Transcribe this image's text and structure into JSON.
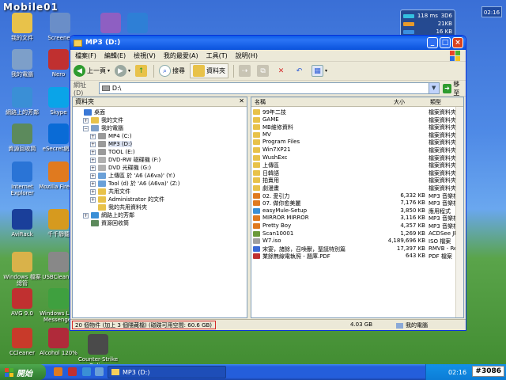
{
  "watermark": "Mobile01",
  "desktop_icons": [
    {
      "label": "我的文件",
      "color": "#e8c24a",
      "icon": "folder-icon"
    },
    {
      "label": "Screener",
      "color": "#6a8ec8",
      "icon": "app-icon"
    },
    {
      "label": "PhotoImpact",
      "color": "#8e5fc2",
      "icon": "app-icon"
    },
    {
      "label": "FetPlayerMini",
      "color": "#2e7fd6",
      "icon": "play-icon"
    },
    {
      "label": "我的電腦",
      "color": "#7d9fc9",
      "icon": "computer-icon"
    },
    {
      "label": "Nero",
      "color": "#c03030",
      "icon": "nero-icon"
    },
    {
      "label": "網路上的芳鄰",
      "color": "#3a8fd6",
      "icon": "network-icon"
    },
    {
      "label": "Skype",
      "color": "#0aa4e8",
      "icon": "skype-icon"
    },
    {
      "label": "資源回收筒",
      "color": "#5c8a5c",
      "icon": "recycle-bin-icon"
    },
    {
      "label": "eSecret網路",
      "color": "#0a6bd6",
      "icon": "info-icon"
    },
    {
      "label": "Internet Explorer",
      "color": "#2a74d6",
      "icon": "ie-icon"
    },
    {
      "label": "Mozilla Firefox",
      "color": "#e07a1f",
      "icon": "firefox-icon"
    },
    {
      "label": "AviRack",
      "color": "#1a3f9a",
      "icon": "app-icon"
    },
    {
      "label": "千千靜聽",
      "color": "#d69a1f",
      "icon": "music-icon"
    },
    {
      "label": "Windows 檔案總管",
      "color": "#d9b24a",
      "icon": "explorer-icon"
    },
    {
      "label": "USBCleaner",
      "color": "#888888",
      "icon": "usb-icon"
    },
    {
      "label": "AVG 9.0",
      "color": "#c03030",
      "icon": "avg-icon"
    },
    {
      "label": "Windows Live Messenger",
      "color": "#3fa03f",
      "icon": "messenger-icon"
    },
    {
      "label": "CCleaner",
      "color": "#c83a2a",
      "icon": "ccleaner-icon"
    },
    {
      "label": "Alcohol 120%",
      "color": "#b02a3a",
      "icon": "alcohol-icon"
    },
    {
      "label": "Counter-Strike Online",
      "color": "#4a4a4a",
      "icon": "game-icon"
    }
  ],
  "gadget": {
    "rows": [
      {
        "left": "118 ms",
        "right": "3D6",
        "color": "#34c0e0"
      },
      {
        "left": "",
        "right": "21KB",
        "color": "#e89a2a"
      },
      {
        "left": "",
        "right": "16 KB",
        "color": "#3a8fe0"
      }
    ],
    "clock": "02:16"
  },
  "window": {
    "title": "MP3 (D:)",
    "menu": [
      "檔案(F)",
      "編輯(E)",
      "檢視(V)",
      "我的最愛(A)",
      "工具(T)",
      "說明(H)"
    ],
    "toolbar": {
      "back": "上一頁",
      "search": "搜尋",
      "folders": "資料夾"
    },
    "address_label": "網址(D)",
    "address_value": "D:\\",
    "go_label": "移至",
    "folder_pane_title": "資料夾",
    "tree": [
      {
        "label": "桌面",
        "indent": 0,
        "pm": "",
        "color": "#3a78d6"
      },
      {
        "label": "我的文件",
        "indent": 1,
        "pm": "+",
        "color": "#e8c24a"
      },
      {
        "label": "我的電腦",
        "indent": 1,
        "pm": "−",
        "color": "#7d9fc9"
      },
      {
        "label": "MP4 (C:)",
        "indent": 2,
        "pm": "+",
        "color": "#9a9a9a"
      },
      {
        "label": "MP3 (D:)",
        "indent": 2,
        "pm": "+",
        "color": "#9a9a9a",
        "selected": true
      },
      {
        "label": "TOOL (E:)",
        "indent": 2,
        "pm": "+",
        "color": "#9a9a9a"
      },
      {
        "label": "DVD-RW 磁碟機 (F:)",
        "indent": 2,
        "pm": "+",
        "color": "#b0b0b0"
      },
      {
        "label": "DVD 光碟機 (G:)",
        "indent": 2,
        "pm": "+",
        "color": "#b0b0b0"
      },
      {
        "label": "上傳區 於 'A6 (A6va)' (Y:)",
        "indent": 2,
        "pm": "+",
        "color": "#6aa0d8"
      },
      {
        "label": "Tool (d) 於 'A6 (A6va)' (Z:)",
        "indent": 2,
        "pm": "+",
        "color": "#6aa0d8"
      },
      {
        "label": "共用文件",
        "indent": 2,
        "pm": "+",
        "color": "#e8c24a"
      },
      {
        "label": "Administrator 的文件",
        "indent": 2,
        "pm": "+",
        "color": "#e8c24a"
      },
      {
        "label": "我的共用資料夾",
        "indent": 2,
        "pm": "",
        "color": "#e8c24a"
      },
      {
        "label": "網路上的芳鄰",
        "indent": 1,
        "pm": "+",
        "color": "#3a8fd6"
      },
      {
        "label": "資源回收筒",
        "indent": 1,
        "pm": "",
        "color": "#5c8a5c"
      }
    ],
    "columns": {
      "name": "名稱",
      "size": "大小",
      "type": "類型"
    },
    "files": [
      {
        "name": "99年二技",
        "size": "",
        "type": "檔案資料夾",
        "color": "#e8c24a"
      },
      {
        "name": "GAME",
        "size": "",
        "type": "檔案資料夾",
        "color": "#e8c24a"
      },
      {
        "name": "MB維修資料",
        "size": "",
        "type": "檔案資料夾",
        "color": "#e8c24a"
      },
      {
        "name": "MV",
        "size": "",
        "type": "檔案資料夾",
        "color": "#e8c24a"
      },
      {
        "name": "Program Files",
        "size": "",
        "type": "檔案資料夾",
        "color": "#e8c24a"
      },
      {
        "name": "Win7XP21",
        "size": "",
        "type": "檔案資料夾",
        "color": "#e8c24a"
      },
      {
        "name": "WushExc",
        "size": "",
        "type": "檔案資料夾",
        "color": "#e8c24a"
      },
      {
        "name": "上傳區",
        "size": "",
        "type": "檔案資料夾",
        "color": "#e8c24a"
      },
      {
        "name": "日韓語",
        "size": "",
        "type": "檔案資料夾",
        "color": "#e8c24a"
      },
      {
        "name": "拍賣用",
        "size": "",
        "type": "檔案資料夾",
        "color": "#e8c24a"
      },
      {
        "name": "劇漫畫",
        "size": "",
        "type": "檔案資料夾",
        "color": "#e8c24a"
      },
      {
        "name": "02. 愛引力",
        "size": "6,332 KB",
        "type": "MP3 音樂檔",
        "color": "#e07a1f"
      },
      {
        "name": "07. 做你愈美麗",
        "size": "7,176 KB",
        "type": "MP3 音樂檔",
        "color": "#e07a1f"
      },
      {
        "name": "easyMule-Setup",
        "size": "3,850 KB",
        "type": "應用程式",
        "color": "#3a8fd6"
      },
      {
        "name": "MIRROR MIRROR",
        "size": "3,116 KB",
        "type": "MP3 音樂檔",
        "color": "#e07a1f"
      },
      {
        "name": "Pretty Boy",
        "size": "4,357 KB",
        "type": "MP3 音樂檔",
        "color": "#e07a1f"
      },
      {
        "name": "Scan10001",
        "size": "1,269 KB",
        "type": "ACDSee JPG",
        "color": "#6a9a3a"
      },
      {
        "name": "W7.iso",
        "size": "4,189,696 KB",
        "type": "ISO 檔案",
        "color": "#a0a0a0"
      },
      {
        "name": "宋宴，諸餘，召喚獸，聖誕特別篇",
        "size": "17,397 KB",
        "type": "RMVB - Re",
        "color": "#3a6ad6"
      },
      {
        "name": "業餘無線電執照 - 題庫.PDF",
        "size": "643 KB",
        "type": "PDF 檔案",
        "color": "#c03030"
      }
    ],
    "status": {
      "objects": "20 個物件 (加上 3 個隱藏檔) (磁碟可用空間: 60.6 GB)",
      "size": "4.03 GB",
      "location": "我的電腦"
    }
  },
  "taskbar": {
    "start_label": "開始",
    "task_label": "MP3 (D:)",
    "clock": "02:16",
    "tag": "#3086"
  }
}
